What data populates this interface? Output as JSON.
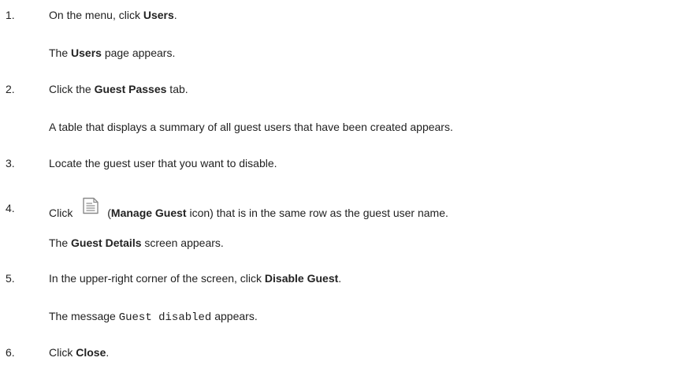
{
  "steps": [
    {
      "num": "1.",
      "pre": "On the menu, click ",
      "bold": "Users",
      "post": ".",
      "result": {
        "pre": "The ",
        "bold": "Users",
        "post": " page appears."
      }
    },
    {
      "num": "2.",
      "pre": "Click the ",
      "bold": "Guest Passes",
      "post": " tab.",
      "result": {
        "text": "A table that displays a summary of all guest users that have been created appears."
      }
    },
    {
      "num": "3.",
      "text": "Locate the guest user that you want to disable."
    },
    {
      "num": "4.",
      "pre": "Click ",
      "icon": "manage-guest-icon",
      "paren_open": "(",
      "bold": "Manage Guest",
      "post": " icon) that is in the same row as the guest user name.",
      "result": {
        "pre": "The ",
        "bold": "Guest Details",
        "post": " screen appears."
      }
    },
    {
      "num": "5.",
      "pre": "In the upper-right corner of the screen, click ",
      "bold": "Disable Guest",
      "post": ".",
      "result": {
        "pre": "The message ",
        "mono": "Guest disabled",
        "post": " appears."
      }
    },
    {
      "num": "6.",
      "pre": "Click ",
      "bold": "Close",
      "post": "."
    }
  ]
}
